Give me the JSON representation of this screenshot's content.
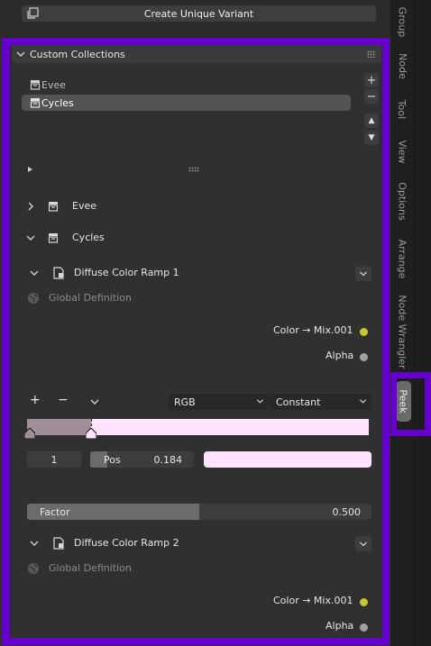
{
  "top": {
    "variant_button": "Create Unique Variant"
  },
  "panel": {
    "title": "Custom Collections",
    "list": [
      "Evee",
      "Cycles"
    ],
    "list_add": "+",
    "list_remove": "−",
    "list_up": "▲",
    "list_down": "▼"
  },
  "collections": {
    "evee": "Evee",
    "cycles": "Cycles"
  },
  "ramp1": {
    "title": "Diffuse Color Ramp 1",
    "global": "Global Definition",
    "color_out": "Color → Mix.001",
    "alpha_out": "Alpha",
    "mode": "RGB",
    "interp": "Constant",
    "stop_index": "1",
    "pos_label": "Pos",
    "pos_value": "0.184",
    "factor_label": "Factor",
    "factor_value": "0.500",
    "factor_fraction": 0.5,
    "swatch_color": "#ffe3ff"
  },
  "ramp2": {
    "title": "Diffuse Color Ramp 2",
    "global": "Global Definition",
    "color_out": "Color → Mix.001",
    "alpha_out": "Alpha"
  },
  "tabs": [
    "Group",
    "Node",
    "Tool",
    "View",
    "Options",
    "Arrange",
    "Node Wrangler",
    "Peek"
  ],
  "colors": {
    "highlight": "#6600cc",
    "color_socket": "#c7c729",
    "alpha_socket": "#a1a1a1"
  },
  "ramp_controls": {
    "plus": "+",
    "minus": "−"
  }
}
